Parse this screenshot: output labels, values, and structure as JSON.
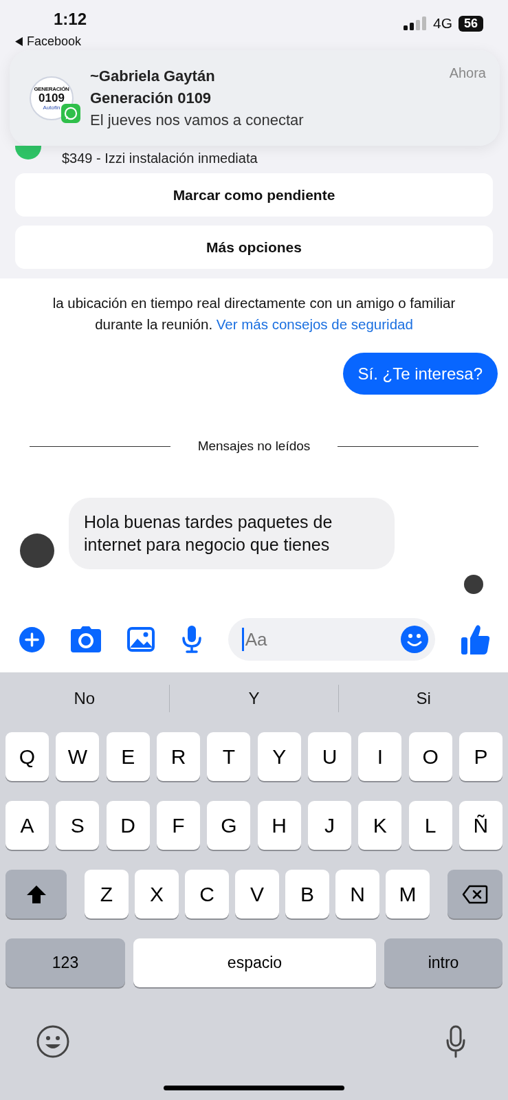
{
  "status_bar": {
    "time": "1:12",
    "back_label": "Facebook",
    "network": "4G",
    "battery": "56"
  },
  "notification": {
    "sender": "~Gabriela Gaytán",
    "group": "Generación 0109",
    "message": "El jueves nos vamos a conectar",
    "time": "Ahora",
    "logo_caption": "GENERACIÓN",
    "logo_number": "0109",
    "logo_footer": "Autofin"
  },
  "sheet": {
    "preview": "$349 - Izzi instalación inmediata",
    "actions": [
      "Marcar como pendiente",
      "Más opciones"
    ]
  },
  "chat": {
    "notice": {
      "text": "la ubicación en tiempo real directamente con un amigo o familiar durante la reunión.",
      "link": "Ver más consejos de seguridad"
    },
    "messages": [
      {
        "kind": "outgoing",
        "text": "Sí. ¿Te interesa?"
      },
      {
        "kind": "divider",
        "text": "Mensajes no leídos"
      },
      {
        "kind": "incoming",
        "text": "Hola buenas tardes paquetes de internet para negocio que tienes"
      }
    ],
    "composer": {
      "placeholder": "Aa"
    }
  },
  "keyboard": {
    "suggestions": [
      "No",
      "Y",
      "Si"
    ],
    "rows": [
      [
        "Q",
        "W",
        "E",
        "R",
        "T",
        "Y",
        "U",
        "I",
        "O",
        "P"
      ],
      [
        "A",
        "S",
        "D",
        "F",
        "G",
        "H",
        "J",
        "K",
        "L",
        "Ñ"
      ],
      [
        "Z",
        "X",
        "C",
        "V",
        "B",
        "N",
        "M"
      ]
    ],
    "numbers_key": "123",
    "space_key": "espacio",
    "return_key": "intro"
  }
}
